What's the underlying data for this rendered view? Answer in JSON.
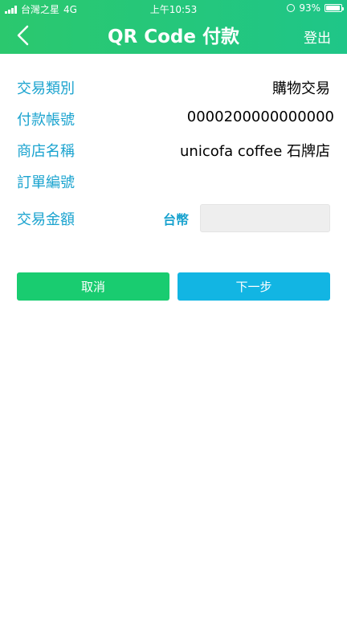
{
  "status_bar": {
    "carrier": "台灣之星",
    "network": "4G",
    "time": "上午10:53",
    "battery_text": "93%",
    "battery_level": 0.93
  },
  "nav": {
    "title": "QR Code 付款",
    "logout_label": "登出"
  },
  "form": {
    "rows": [
      {
        "label": "交易類別",
        "value": "購物交易"
      },
      {
        "label": "付款帳號",
        "value": "0000200000000000"
      },
      {
        "label": "商店名稱",
        "value": "unicofa coffee 石牌店"
      },
      {
        "label": "訂單編號",
        "value": ""
      }
    ],
    "amount": {
      "label": "交易金額",
      "currency": "台幣",
      "value": "",
      "placeholder": ""
    }
  },
  "buttons": {
    "cancel_label": "取消",
    "next_label": "下一步"
  },
  "colors": {
    "header_green": "#2bc86e",
    "label_blue": "#1aa3cf",
    "cancel_green": "#19cc70",
    "next_blue": "#12b5e3"
  }
}
